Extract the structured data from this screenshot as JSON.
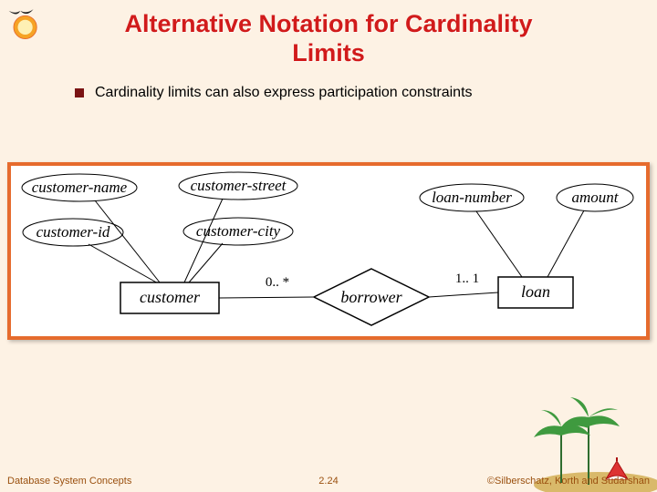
{
  "title_line1": "Alternative Notation for Cardinality",
  "title_line2": "Limits",
  "bullet": "Cardinality limits can also express participation constraints",
  "footer": {
    "left": "Database System Concepts",
    "mid": "2.24",
    "right": "©Silberschatz, Korth and Sudarshan"
  },
  "er": {
    "attrs": {
      "customer_name": "customer-name",
      "customer_id": "customer-id",
      "customer_street": "customer-street",
      "customer_city": "customer-city",
      "loan_number": "loan-number",
      "amount": "amount"
    },
    "entities": {
      "customer": "customer",
      "loan": "loan"
    },
    "relationship": "borrower",
    "cardinality": {
      "left": "0.. *",
      "right": "1.. 1"
    }
  }
}
